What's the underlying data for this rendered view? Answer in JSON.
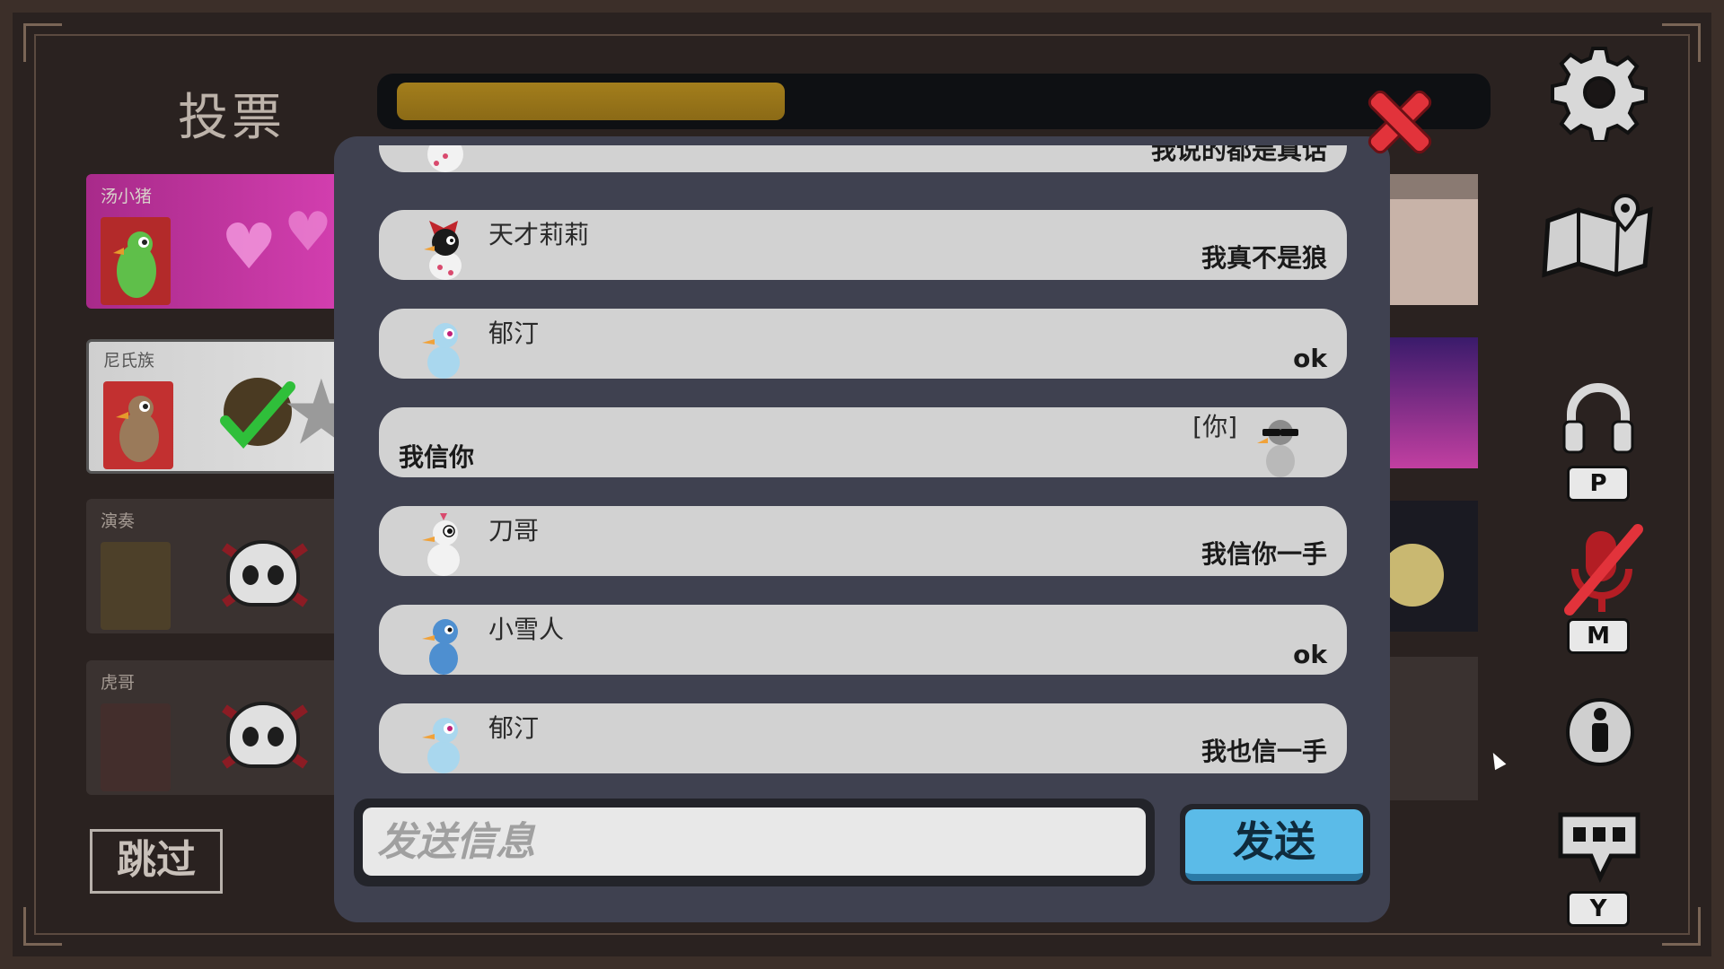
{
  "title": "投票",
  "timer": {
    "progress": 0.36,
    "fill_color": "#9a7519"
  },
  "players": [
    {
      "name": "汤小猪",
      "status": "alive",
      "bg": "pink-hearts"
    },
    {
      "name": "尼氏族",
      "status": "voted",
      "bg": "star"
    },
    {
      "name": "演奏",
      "status": "dead"
    },
    {
      "name": "虎哥",
      "status": "dead"
    }
  ],
  "skip_label": "跳过",
  "chat": {
    "messages": [
      {
        "name": "",
        "text": "我说的都是真话",
        "avatar": "black-duck-polka"
      },
      {
        "name": "天才莉莉",
        "text": "我真不是狼",
        "avatar": "black-duck-bow"
      },
      {
        "name": "郁汀",
        "text": "ok",
        "avatar": "light-blue-duck"
      },
      {
        "name": "",
        "you_label": "[你]",
        "text": "我信你",
        "avatar": "grey-duck-sunglasses",
        "mine": true
      },
      {
        "name": "刀哥",
        "text": "我信你一手",
        "avatar": "white-duck"
      },
      {
        "name": "小雪人",
        "text": "ok",
        "avatar": "blue-duck"
      },
      {
        "name": "郁汀",
        "text": "我也信一手",
        "avatar": "light-blue-duck"
      }
    ],
    "input_placeholder": "发送信息",
    "send_label": "发送"
  },
  "sidebar": {
    "settings_icon": "gear-icon",
    "map_icon": "map-icon",
    "push_to_talk_key": "P",
    "mute_key": "M",
    "chat_key": "Y"
  },
  "colors": {
    "close": "#e2333b",
    "send": "#5bbbe8",
    "bubble": "#d2d2d2",
    "panel": "#3f4150"
  }
}
